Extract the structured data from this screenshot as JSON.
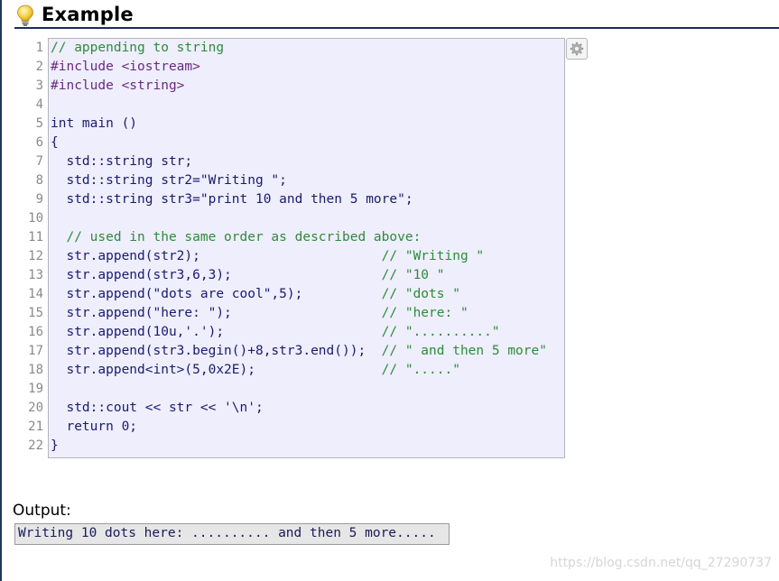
{
  "heading": {
    "title": "Example",
    "icon": "lightbulb-icon"
  },
  "code": {
    "line_numbers": [
      "1",
      "2",
      "3",
      "4",
      "5",
      "6",
      "7",
      "8",
      "9",
      "10",
      "11",
      "12",
      "13",
      "14",
      "15",
      "16",
      "17",
      "18",
      "19",
      "20",
      "21",
      "22"
    ],
    "lines": [
      "// appending to string",
      "#include <iostream>",
      "#include <string>",
      "",
      "int main ()",
      "{",
      "  std::string str;",
      "  std::string str2=\"Writing \";",
      "  std::string str3=\"print 10 and then 5 more\";",
      "",
      "  // used in the same order as described above:",
      "  str.append(str2);                       // \"Writing \"",
      "  str.append(str3,6,3);                   // \"10 \"",
      "  str.append(\"dots are cool\",5);          // \"dots \"",
      "  str.append(\"here: \");                   // \"here: \"",
      "  str.append(10u,'.');                    // \"..........\"",
      "  str.append(str3.begin()+8,str3.end());  // \" and then 5 more\"",
      "  str.append<int>(5,0x2E);                // \".....\"",
      "",
      "  std::cout << str << '\\n';",
      "  return 0;",
      "}"
    ],
    "colors": {
      "background": "#eeeefc",
      "text": "#1a1a6e",
      "comment": "#2e8b3a",
      "preprocessor": "#6a2a80"
    }
  },
  "toolbar": {
    "options_icon": "gear-icon"
  },
  "output": {
    "label": "Output:",
    "text": "Writing 10 dots here: .......... and then 5 more....."
  },
  "watermark": "https://blog.csdn.net/qq_27290737"
}
